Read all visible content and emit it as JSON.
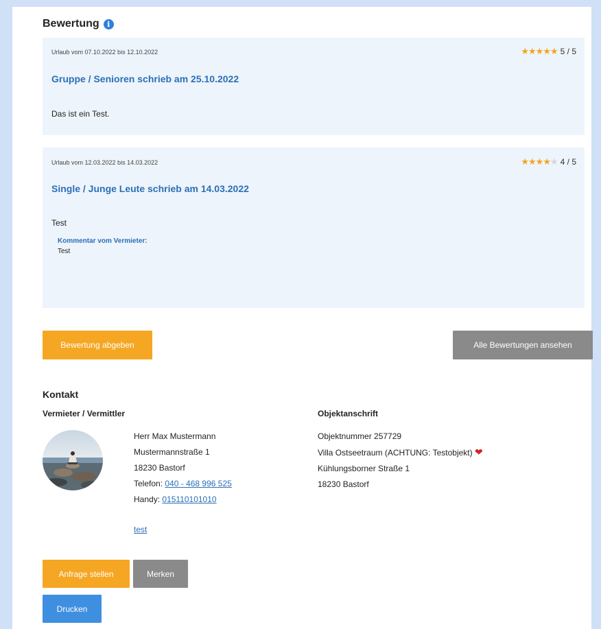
{
  "bewertung": {
    "title": "Bewertung",
    "info_icon": "info-icon",
    "reviews": [
      {
        "period": "Urlaub vom 07.10.2022 bis 12.10.2022",
        "rating": 5,
        "rating_max": 5,
        "rating_text": "5 / 5",
        "author": "Gruppe / Senioren schrieb am 25.10.2022",
        "text": "Das ist ein Test."
      },
      {
        "period": "Urlaub vom 12.03.2022 bis 14.03.2022",
        "rating": 4,
        "rating_max": 5,
        "rating_text": "4 / 5",
        "author": "Single / Junge Leute schrieb am 14.03.2022",
        "text": "Test",
        "comment_heading": "Kommentar vom Vermieter:",
        "comment_text": "Test"
      }
    ],
    "submit_button": "Bewertung abgeben",
    "all_button": "Alle Bewertungen ansehen"
  },
  "kontakt": {
    "title": "Kontakt",
    "vermieter": {
      "heading": "Vermieter / Vermittler",
      "name": "Herr Max Mustermann",
      "street": "Mustermannstraße 1",
      "city": "18230 Bastorf",
      "phone_label": "Telefon:",
      "phone": "040 - 468 996 525",
      "mobile_label": "Handy:",
      "mobile": "015110101010",
      "link": "test"
    },
    "objekt": {
      "heading": "Objektanschrift",
      "number": "Objektnummer 257729",
      "name": "Villa Ostseetraum (ACHTUNG: Testobjekt)",
      "street": "Kühlungsborner Straße 1",
      "city": "18230 Bastorf"
    }
  },
  "actions": {
    "anfrage": "Anfrage stellen",
    "merken": "Merken",
    "drucken": "Drucken"
  },
  "colors": {
    "accent_orange": "#f5a623",
    "accent_blue": "#3e8fe0",
    "link_blue": "#2a6fb8",
    "card_bg": "#eef4fb",
    "button_grey": "#8a8a8a"
  }
}
